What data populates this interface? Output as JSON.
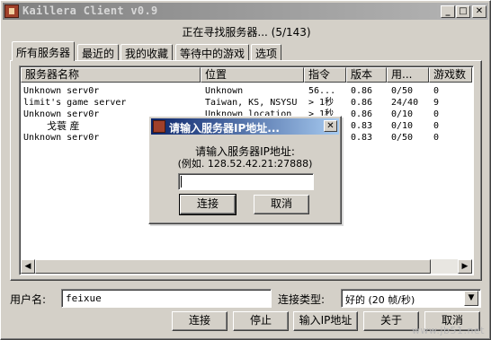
{
  "window": {
    "title": "Kaillera Client v0.9",
    "minimize_glyph": "_",
    "maximize_glyph": "□",
    "close_glyph": "✕"
  },
  "status_text": "正在寻找服务器... (5/143)",
  "tabs": [
    {
      "label": "所有服务器",
      "active": true
    },
    {
      "label": "最近的",
      "active": false
    },
    {
      "label": "我的收藏",
      "active": false
    },
    {
      "label": "等待中的游戏",
      "active": false
    },
    {
      "label": "选项",
      "active": false
    }
  ],
  "server_list": {
    "columns": [
      "服务器名称",
      "位置",
      "指令",
      "版本",
      "用...",
      "游戏数"
    ],
    "rows": [
      [
        "Unknown serv0r",
        "Unknown",
        "56...",
        "0.86",
        "0/50",
        "0"
      ],
      [
        "limit's game server",
        "Taiwan, KS, NSYSU",
        "> 1秒",
        "0.86",
        "24/40",
        "9"
      ],
      [
        "Unknown serv0r",
        "Unknown location",
        "> 1秒",
        "0.86",
        "0/10",
        "0"
      ],
      [
        "戈蓑  産",
        "",
        "",
        "0.83",
        "0/10",
        "0"
      ],
      [
        "Unknown serv0r",
        "",
        "",
        "0.83",
        "0/50",
        "0"
      ]
    ],
    "scroll_left_glyph": "◀",
    "scroll_right_glyph": "▶"
  },
  "bottom": {
    "username_label": "用户名:",
    "username_value": "feixue",
    "conn_type_label": "连接类型:",
    "conn_type_value": "好的 (20 帧/秒)",
    "dropdown_glyph": "▼",
    "buttons": {
      "connect": "连接",
      "stop": "停止",
      "enter_ip": "输入IP地址",
      "about": "关于",
      "cancel": "取消"
    }
  },
  "dialog": {
    "title": "请输入服务器IP地址...",
    "prompt": "请输入服务器IP地址:",
    "example": "(例如. 128.52.42.21:27888)",
    "ip_value": "",
    "connect_label": "连接",
    "cancel_label": "取消",
    "close_glyph": "✕"
  },
  "watermark": "www.jb51.net"
}
